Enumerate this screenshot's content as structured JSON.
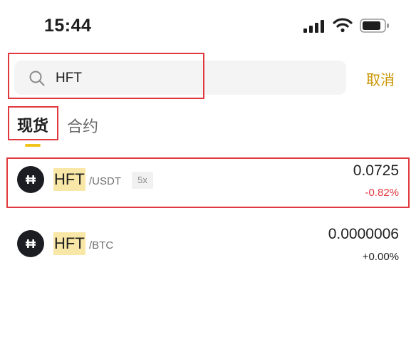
{
  "status_bar": {
    "time": "15:44",
    "icons": [
      "signal-icon",
      "wifi-icon",
      "battery-icon"
    ]
  },
  "search": {
    "value": "HFT",
    "icon": "search-icon",
    "cancel_label": "取消"
  },
  "tabs": [
    {
      "label": "现货",
      "active": true
    },
    {
      "label": "合约",
      "active": false
    }
  ],
  "results": [
    {
      "base": "HFT",
      "quote": "/USDT",
      "leverage": "5x",
      "price": "0.0725",
      "change": "-0.82%",
      "change_color": "#e0383e"
    },
    {
      "base": "HFT",
      "quote": "/BTC",
      "price": "0.0000006",
      "change": "+0.00%",
      "change_color": "#1e1e1e"
    }
  ],
  "colors": {
    "accent": "#c99400",
    "tab_indicator": "#f0c419",
    "highlight_frame": "#e0383e",
    "negative": "#e0383e"
  }
}
